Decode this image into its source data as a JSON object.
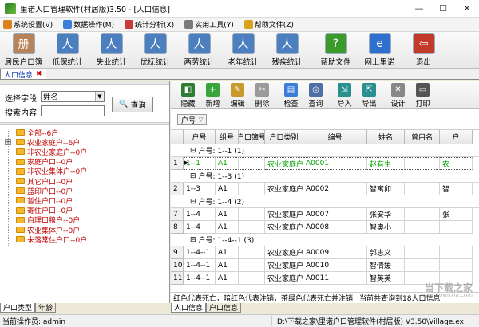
{
  "window": {
    "title": "里诺人口管理软件(村居版)3.50 - [人口信息]",
    "controls": [
      "—",
      "☐",
      "✕"
    ]
  },
  "menu": [
    {
      "label": "系统设置(V)",
      "color": "#d9821e"
    },
    {
      "label": "数据操作(M)",
      "color": "#3b7dd8"
    },
    {
      "label": "统计分析(X)",
      "color": "#c93a3a"
    },
    {
      "label": "实用工具(Y)",
      "color": "#7a7a7a"
    },
    {
      "label": "帮助文件(Z)",
      "color": "#d7a21e"
    }
  ],
  "toolbar": [
    {
      "label": "居民户口簿",
      "icon": "household-book-icon",
      "color": "#b7835a",
      "glyph": "册"
    },
    {
      "label": "低保统计",
      "icon": "person-stats-icon",
      "color": "#4c7fc0",
      "glyph": "人"
    },
    {
      "label": "失业统计",
      "icon": "person-stats-icon",
      "color": "#4c7fc0",
      "glyph": "人"
    },
    {
      "label": "优抚统计",
      "icon": "person-stats-icon",
      "color": "#4c7fc0",
      "glyph": "人"
    },
    {
      "label": "两劳统计",
      "icon": "person-stats-icon",
      "color": "#4c7fc0",
      "glyph": "人"
    },
    {
      "label": "老年统计",
      "icon": "person-stats-icon",
      "color": "#4c7fc0",
      "glyph": "人"
    },
    {
      "label": "残疾统计",
      "icon": "person-stats-icon",
      "color": "#4c7fc0",
      "glyph": "人"
    },
    {
      "label": "帮助文件",
      "icon": "help-icon",
      "color": "#3a9a2a",
      "glyph": "?"
    },
    {
      "label": "网上里诺",
      "icon": "globe-icon",
      "color": "#2f6fcf",
      "glyph": "e"
    },
    {
      "label": "退出",
      "icon": "exit-door-icon",
      "color": "#c23a2a",
      "glyph": "⇦"
    }
  ],
  "doc_tab": {
    "label": "人口信息",
    "close": "✖"
  },
  "search": {
    "field_label": "选择字段",
    "field_value": "姓名",
    "content_label": "搜索内容",
    "content_value": "",
    "button_label": "查询",
    "button_icon": "🔍"
  },
  "tree": [
    {
      "label": "全部--6户",
      "indent": 0
    },
    {
      "label": "农业家庭户--6户",
      "indent": 0,
      "expander": "+"
    },
    {
      "label": "非农业家庭户--0户",
      "indent": 0
    },
    {
      "label": "家庭户口--0户",
      "indent": 0
    },
    {
      "label": "非农业集体户--0户",
      "indent": 0
    },
    {
      "label": "其它户口--0户",
      "indent": 0
    },
    {
      "label": "蓝印户口--0户",
      "indent": 0
    },
    {
      "label": "暂住户口--0户",
      "indent": 0
    },
    {
      "label": "寄住户口--0户",
      "indent": 0
    },
    {
      "label": "自理口粮户--0户",
      "indent": 0
    },
    {
      "label": "农业集体户--0户",
      "indent": 0
    },
    {
      "label": "未落常住户口--0户",
      "indent": 0
    }
  ],
  "left_tabs": [
    "户口类型",
    "年龄"
  ],
  "right_toolbar": [
    {
      "label": "隐藏",
      "icon": "hide-icon",
      "color": "#2e7d32",
      "glyph": "◧"
    },
    {
      "label": "新增",
      "icon": "add-icon",
      "color": "#3aa53a",
      "glyph": "+"
    },
    {
      "label": "编辑",
      "icon": "edit-icon",
      "color": "#c79a2a",
      "glyph": "✎"
    },
    {
      "label": "删除",
      "icon": "delete-icon",
      "color": "#9a9a9a",
      "glyph": "✂"
    },
    {
      "label": "检查",
      "icon": "check-icon",
      "color": "#3b7dd8",
      "glyph": "▤"
    },
    {
      "label": "查询",
      "icon": "search-icon",
      "color": "#4d6fa6",
      "glyph": "◎"
    },
    {
      "label": "导入",
      "icon": "import-icon",
      "color": "#2a8f8f",
      "glyph": "⇲"
    },
    {
      "label": "导出",
      "icon": "export-icon",
      "color": "#2a8f8f",
      "glyph": "⇱"
    },
    {
      "label": "设计",
      "icon": "design-icon",
      "color": "#888888",
      "glyph": "✕"
    },
    {
      "label": "打印",
      "icon": "print-icon",
      "color": "#555555",
      "glyph": "▭"
    }
  ],
  "group_chip": {
    "label": "户号",
    "filter": "▽"
  },
  "grid": {
    "columns": [
      "户号",
      "组号",
      "户口簿号",
      "户口类别",
      "编号",
      "姓名",
      "曾用名",
      "户"
    ],
    "groups": [
      {
        "label": "户号: 1--1 (1)",
        "rows": [
          {
            "n": "1",
            "marker": "▶",
            "cells": [
              "1--1",
              "A1",
              "",
              "农业家庭户",
              "A0001",
              "赵有生",
              "",
              "农"
            ],
            "green": true
          }
        ]
      },
      {
        "label": "户号: 1--3 (1)",
        "rows": [
          {
            "n": "2",
            "cells": [
              "1--3",
              "A1",
              "",
              "农业家庭户",
              "A0002",
              "智寓卯",
              "",
              "智"
            ]
          }
        ]
      },
      {
        "label": "户号: 1--4 (2)",
        "rows": [
          {
            "n": "7",
            "cells": [
              "1--4",
              "A1",
              "",
              "农业家庭户",
              "A0007",
              "张安华",
              "",
              "张"
            ]
          },
          {
            "n": "8",
            "cells": [
              "1--4",
              "A1",
              "",
              "农业家庭户",
              "A0008",
              "智奥小",
              "",
              ""
            ]
          }
        ]
      },
      {
        "label": "户号: 1--4--1 (3)",
        "rows": [
          {
            "n": "9",
            "cells": [
              "1--4--1",
              "A1",
              "",
              "农业家庭户",
              "A0009",
              "郭志义",
              "",
              ""
            ]
          },
          {
            "n": "10",
            "cells": [
              "1--4--1",
              "A1",
              "",
              "农业家庭户",
              "A0010",
              "智倩媛",
              "",
              ""
            ]
          },
          {
            "n": "11",
            "cells": [
              "1--4--1",
              "A1",
              "",
              "农业家庭户",
              "A0011",
              "智英英",
              "",
              ""
            ]
          }
        ]
      }
    ]
  },
  "status_note": "红色代表死亡，暗红色代表注销，茶绿色代表死亡并注销",
  "status_count": "当前共查询到18人口信息",
  "right_tabs": [
    "人口信息",
    "户口信息"
  ],
  "statusbar": {
    "operator": "当前操作员: admin",
    "path": "D:\\下载之家\\里诺户口管理软件(村居版) V3.50\\Village.ex"
  },
  "watermark": {
    "main": "当下载之家",
    "sub": "www.downxia.com"
  }
}
